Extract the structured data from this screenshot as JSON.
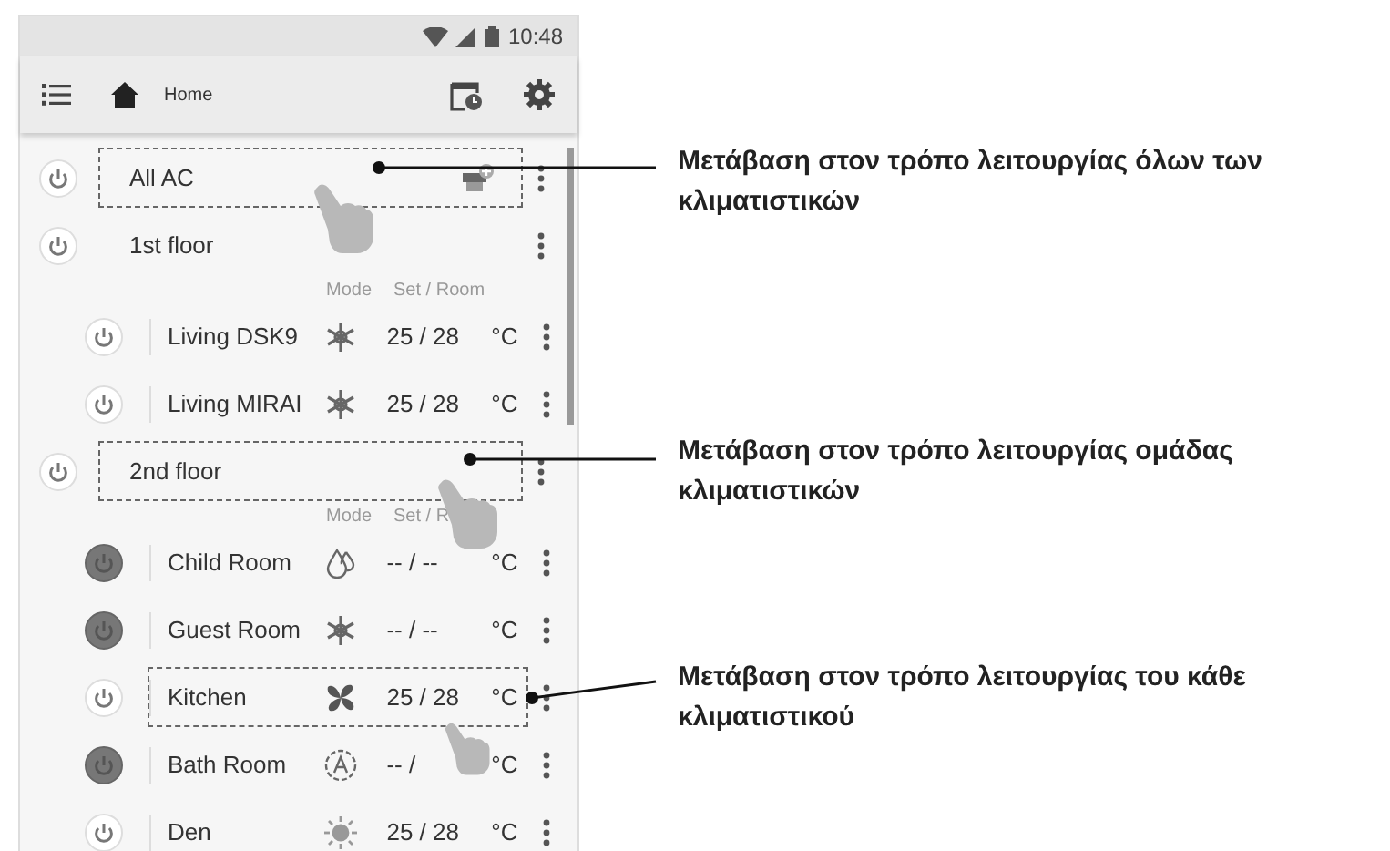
{
  "status_bar": {
    "time": "10:48"
  },
  "toolbar": {
    "title": "Home"
  },
  "list": [
    {
      "kind": "all",
      "name": "All AC",
      "on": false,
      "highlighted": true
    },
    {
      "kind": "group",
      "name": "1st floor",
      "on": false,
      "highlighted": false
    },
    {
      "kind": "header",
      "mode_label": "Mode",
      "set_label": "Set / Room"
    },
    {
      "kind": "unit",
      "name": "Living DSK9",
      "on": false,
      "mode": {
        "kind": "cool"
      },
      "temperature": "25 / 28",
      "unit": "°C",
      "highlighted": false
    },
    {
      "kind": "unit",
      "name": "Living MIRAI",
      "on": false,
      "mode": {
        "kind": "cool"
      },
      "temperature": "25 / 28",
      "unit": "°C",
      "highlighted": false
    },
    {
      "kind": "group",
      "name": "2nd floor",
      "on": false,
      "highlighted": true
    },
    {
      "kind": "header",
      "mode_label": "Mode",
      "set_label": "Set / R"
    },
    {
      "kind": "unit",
      "name": "Child Room",
      "on": true,
      "mode": {
        "kind": "dry"
      },
      "temperature": "-- / --",
      "unit": "°C",
      "highlighted": false
    },
    {
      "kind": "unit",
      "name": "Guest Room",
      "on": true,
      "mode": {
        "kind": "cool"
      },
      "temperature": "-- / --",
      "unit": "°C",
      "highlighted": false
    },
    {
      "kind": "unit",
      "name": "Kitchen",
      "on": false,
      "mode": {
        "kind": "fan"
      },
      "temperature": "25 / 28",
      "unit": "°C",
      "highlighted": true
    },
    {
      "kind": "unit",
      "name": "Bath Room",
      "on": true,
      "mode": {
        "kind": "auto"
      },
      "temperature": "-- /",
      "unit": "°C",
      "highlighted": false
    },
    {
      "kind": "unit",
      "name": "Den",
      "on": false,
      "mode": {
        "kind": "heat"
      },
      "temperature": "25 / 28",
      "unit": "°C",
      "highlighted": false
    }
  ],
  "callouts": [
    {
      "text": "Μετάβαση στον τρόπο λειτουργίας όλων των κλιματιστικών"
    },
    {
      "text": "Μετάβαση στον τρόπο λειτουργίας ομάδας κλιματιστικών"
    },
    {
      "text": "Μετάβαση στον τρόπο λειτουργίας του κάθε κλιματιστικού"
    }
  ]
}
